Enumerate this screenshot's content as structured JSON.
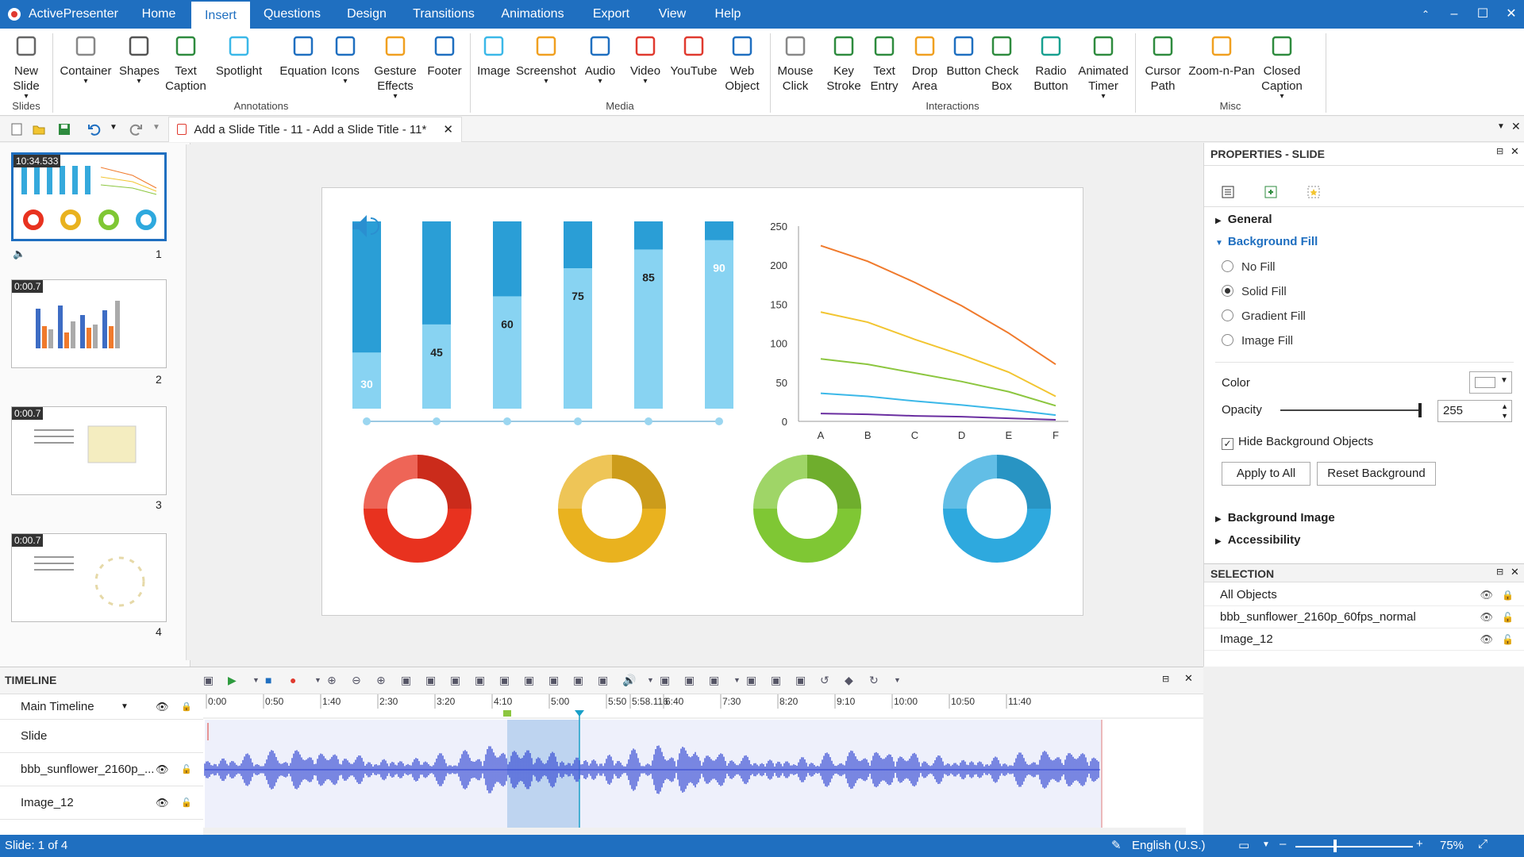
{
  "app": {
    "name": "ActivePresenter"
  },
  "menu": {
    "tabs": [
      {
        "label": "Home"
      },
      {
        "label": "Insert"
      },
      {
        "label": "Questions"
      },
      {
        "label": "Design"
      },
      {
        "label": "Transitions"
      },
      {
        "label": "Animations"
      },
      {
        "label": "Export"
      },
      {
        "label": "View"
      },
      {
        "label": "Help"
      }
    ],
    "active": "Insert"
  },
  "ribbon": {
    "groups": {
      "slides": "Slides",
      "annotations": "Annotations",
      "media": "Media",
      "interactions": "Interactions",
      "misc": "Misc"
    },
    "buttons": [
      {
        "l1": "New",
        "l2": "Slide",
        "icon": "new-slide-icon"
      },
      {
        "l1": "Container",
        "l2": "",
        "icon": "container-icon"
      },
      {
        "l1": "Shapes",
        "l2": "",
        "icon": "shapes-icon"
      },
      {
        "l1": "Text",
        "l2": "Caption",
        "icon": "text-caption-icon"
      },
      {
        "l1": "Spotlight",
        "l2": "",
        "icon": "spotlight-icon"
      },
      {
        "l1": "Equation",
        "l2": "",
        "icon": "equation-icon"
      },
      {
        "l1": "Icons",
        "l2": "",
        "icon": "icons-icon"
      },
      {
        "l1": "Gesture",
        "l2": "Effects",
        "icon": "gesture-icon"
      },
      {
        "l1": "Footer",
        "l2": "",
        "icon": "footer-icon"
      },
      {
        "l1": "Image",
        "l2": "",
        "icon": "image-icon"
      },
      {
        "l1": "Screenshot",
        "l2": "",
        "icon": "screenshot-icon"
      },
      {
        "l1": "Audio",
        "l2": "",
        "icon": "audio-icon"
      },
      {
        "l1": "Video",
        "l2": "",
        "icon": "video-icon"
      },
      {
        "l1": "YouTube",
        "l2": "",
        "icon": "youtube-icon"
      },
      {
        "l1": "Web",
        "l2": "Object",
        "icon": "web-object-icon"
      },
      {
        "l1": "Mouse",
        "l2": "Click",
        "icon": "mouse-click-icon"
      },
      {
        "l1": "Key",
        "l2": "Stroke",
        "icon": "key-stroke-icon"
      },
      {
        "l1": "Text",
        "l2": "Entry",
        "icon": "text-entry-icon"
      },
      {
        "l1": "Drop",
        "l2": "Area",
        "icon": "drop-area-icon"
      },
      {
        "l1": "Button",
        "l2": "",
        "icon": "button-icon"
      },
      {
        "l1": "Check",
        "l2": "Box",
        "icon": "check-box-icon"
      },
      {
        "l1": "Radio",
        "l2": "Button",
        "icon": "radio-button-icon"
      },
      {
        "l1": "Animated",
        "l2": "Timer",
        "icon": "animated-timer-icon"
      },
      {
        "l1": "Cursor",
        "l2": "Path",
        "icon": "cursor-path-icon"
      },
      {
        "l1": "Zoom-n-Pan",
        "l2": "",
        "icon": "zoom-n-pan-icon"
      },
      {
        "l1": "Closed",
        "l2": "Caption",
        "icon": "closed-caption-icon"
      }
    ]
  },
  "document": {
    "tab_title": "Add a Slide Title - 11 - Add a Slide Title - 11*"
  },
  "slides": [
    {
      "time": "10:34.533",
      "number": "1"
    },
    {
      "time": "0:00.7",
      "number": "2"
    },
    {
      "time": "0:00.7",
      "number": "3"
    },
    {
      "time": "0:00.7",
      "number": "4"
    }
  ],
  "slide": {
    "bars": [
      30,
      45,
      60,
      75,
      85,
      90
    ],
    "line_chart": {
      "categories": [
        "A",
        "B",
        "C",
        "D",
        "E",
        "F"
      ],
      "yticks": [
        "250",
        "200",
        "150",
        "100",
        "50",
        "0"
      ],
      "ylim": [
        0,
        250
      ],
      "series": [
        {
          "color": "#f07a2c",
          "values": [
            225,
            205,
            178,
            148,
            113,
            73
          ]
        },
        {
          "color": "#f2c531",
          "values": [
            140,
            127,
            105,
            85,
            63,
            32
          ]
        },
        {
          "color": "#8cc63f",
          "values": [
            80,
            73,
            62,
            51,
            38,
            20
          ]
        },
        {
          "color": "#3bb8e8",
          "values": [
            36,
            32,
            26,
            21,
            15,
            8
          ]
        },
        {
          "color": "#6a2ea0",
          "values": [
            10,
            9,
            7,
            6,
            4,
            2
          ]
        }
      ]
    },
    "donuts": [
      {
        "color": "#e8321f"
      },
      {
        "color": "#e9b21f"
      },
      {
        "color": "#7fc734"
      },
      {
        "color": "#2ea9de"
      }
    ]
  },
  "properties": {
    "title": "PROPERTIES - SLIDE",
    "general": "General",
    "bg_fill": "Background Fill",
    "fills": [
      "No Fill",
      "Solid Fill",
      "Gradient Fill",
      "Image Fill"
    ],
    "selected_fill": "Solid Fill",
    "color_label": "Color",
    "opacity_label": "Opacity",
    "opacity_value": "255",
    "hide_bg": "Hide Background Objects",
    "apply_all": "Apply to All",
    "reset_bg": "Reset Background",
    "bg_image": "Background Image",
    "accessibility": "Accessibility"
  },
  "selection": {
    "title": "SELECTION",
    "rows": [
      "All Objects",
      "bbb_sunflower_2160p_60fps_normal",
      "Image_12"
    ]
  },
  "timeline": {
    "title": "TIMELINE",
    "main": "Main Timeline",
    "ticks": [
      "0:00",
      "0:50",
      "1:40",
      "2:30",
      "3:20",
      "4:10",
      "5:00",
      "5:50",
      "5:58.116",
      "6:40",
      "7:30",
      "8:20",
      "9:10",
      "10:00",
      "10:50",
      "11:40"
    ],
    "rows": [
      "Slide",
      "bbb_sunflower_2160p_...",
      "Image_12"
    ]
  },
  "status": {
    "slide": "Slide: 1 of 4",
    "language": "English (U.S.)",
    "zoom": "75%"
  }
}
